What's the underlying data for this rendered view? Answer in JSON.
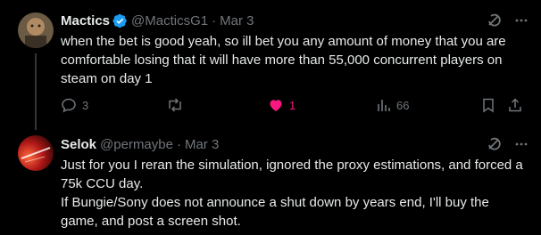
{
  "tweets": [
    {
      "name": "Mactics",
      "handle": "@MacticsG1",
      "date": "Mar 3",
      "text": "when the bet is good yeah, so ill bet you any amount of money that you are comfortable losing that it will have more than 55,000 concurrent players on steam on day 1",
      "replies": "3",
      "likes": "1",
      "views": "66"
    },
    {
      "name": "Selok",
      "handle": "@permaybe",
      "date": "Mar 3",
      "text_line1": "Just for you I reran the simulation, ignored the proxy estimations, and forced a 75k CCU day.",
      "text_line2": "If Bungie/Sony does not announce a shut down by years end, I'll buy the game, and post a screen shot."
    }
  ],
  "separator": "·",
  "colors": {
    "background": "#000000",
    "text": "#e7e9ea",
    "muted": "#71767b",
    "verified": "#1d9bf0",
    "like": "#f91880"
  },
  "icons": [
    "verified-badge-icon",
    "grok-icon",
    "more-icon",
    "reply-icon",
    "retweet-icon",
    "like-icon",
    "views-icon",
    "bookmark-icon",
    "share-icon"
  ]
}
